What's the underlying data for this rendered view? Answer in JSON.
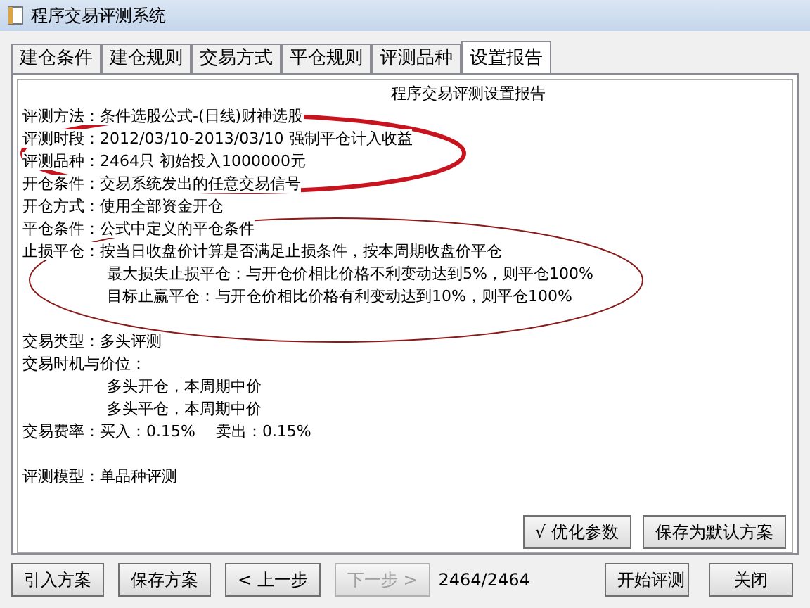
{
  "window": {
    "title": "程序交易评测系统"
  },
  "tabs": [
    {
      "label": "建仓条件",
      "selected": false
    },
    {
      "label": "建仓规则",
      "selected": false
    },
    {
      "label": "交易方式",
      "selected": false
    },
    {
      "label": "平仓规则",
      "selected": false
    },
    {
      "label": "评测品种",
      "selected": false
    },
    {
      "label": "设置报告",
      "selected": true
    }
  ],
  "report": {
    "title": "程序交易评测设置报告",
    "lines": [
      {
        "kind": "line",
        "text": "评测方法：条件选股公式-(日线)财神选股"
      },
      {
        "kind": "line",
        "text": "评测时段：2012/03/10-2013/03/10 强制平仓计入收益"
      },
      {
        "kind": "line",
        "text": "评测品种：2464只 初始投入1000000元"
      },
      {
        "kind": "line",
        "text": "开仓条件：交易系统发出的任意交易信号"
      },
      {
        "kind": "line",
        "text": "开仓方式：使用全部资金开仓"
      },
      {
        "kind": "line",
        "text": "平仓条件：公式中定义的平仓条件"
      },
      {
        "kind": "line",
        "text": "止损平仓：按当日收盘价计算是否满足止损条件，按本周期收盘价平仓"
      },
      {
        "kind": "indent",
        "text": "最大损失止损平仓：与开仓价相比价格不利变动达到5%，则平仓100%"
      },
      {
        "kind": "indent",
        "text": "目标止赢平仓：与开仓价相比价格有利变动达到10%，则平仓100%"
      },
      {
        "kind": "blank"
      },
      {
        "kind": "line",
        "text": "交易类型：多头评测"
      },
      {
        "kind": "line",
        "text": "交易时机与价位："
      },
      {
        "kind": "indent",
        "text": "多头开仓，本周期中价"
      },
      {
        "kind": "indent",
        "text": "多头平仓，本周期中价"
      },
      {
        "kind": "line",
        "text": "交易费率：买入：0.15%　 卖出：0.15%"
      },
      {
        "kind": "blank"
      },
      {
        "kind": "line",
        "text": "评测模型：单品种评测"
      }
    ]
  },
  "panel_buttons": [
    {
      "label": "√ 优化参数"
    },
    {
      "label": "保存为默认方案"
    }
  ],
  "footer": {
    "buttons": [
      {
        "label": "引入方案",
        "disabled": false
      },
      {
        "label": "保存方案",
        "disabled": false
      },
      {
        "label": "< 上一步",
        "disabled": false
      },
      {
        "label": "下一步 >",
        "disabled": true
      }
    ],
    "counter": "2464/2464",
    "right_buttons": [
      {
        "label": "开始评测"
      },
      {
        "label": "关闭"
      }
    ]
  }
}
